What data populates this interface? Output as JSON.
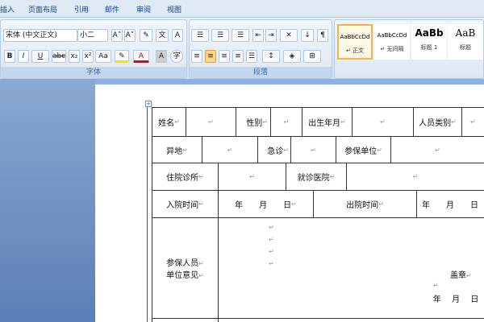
{
  "tabs": [
    "插入",
    "页面布局",
    "引用",
    "邮件",
    "审阅",
    "视图"
  ],
  "font_group": {
    "font_name": "宋体 (中文正文)",
    "font_size": "小二",
    "label": "字体",
    "buttons": [
      "A˄",
      "A˅",
      "B",
      "I",
      "U",
      "abc",
      "x₂",
      "x²",
      "Aa",
      "A",
      "A"
    ]
  },
  "para_group": {
    "label": "段落"
  },
  "styles": [
    {
      "sample": "AaBbCcDd",
      "name": "↵ 正文"
    },
    {
      "sample": "AaBbCcDd",
      "name": "↵ 无间隔"
    },
    {
      "sample": "AaBb",
      "name": "标题 1"
    },
    {
      "sample": "AaB",
      "name": "标题"
    }
  ],
  "table": {
    "row1": [
      "姓名",
      "",
      "性别",
      "",
      "出生年月",
      "",
      "人员类别",
      ""
    ],
    "row2": [
      "异地",
      "",
      "急诊",
      "",
      "参保单位",
      ""
    ],
    "row3": [
      "住院诊所",
      "",
      "就诊医院",
      ""
    ],
    "row4": [
      "入院时间",
      "年　　月　　日",
      "出院时间",
      "年　　月　　日"
    ],
    "row5": {
      "label1": "参保人员",
      "label2": "单位意见",
      "stamp": "盖章",
      "date": "年　 月　 日"
    }
  },
  "paragraph_mark": "↵"
}
